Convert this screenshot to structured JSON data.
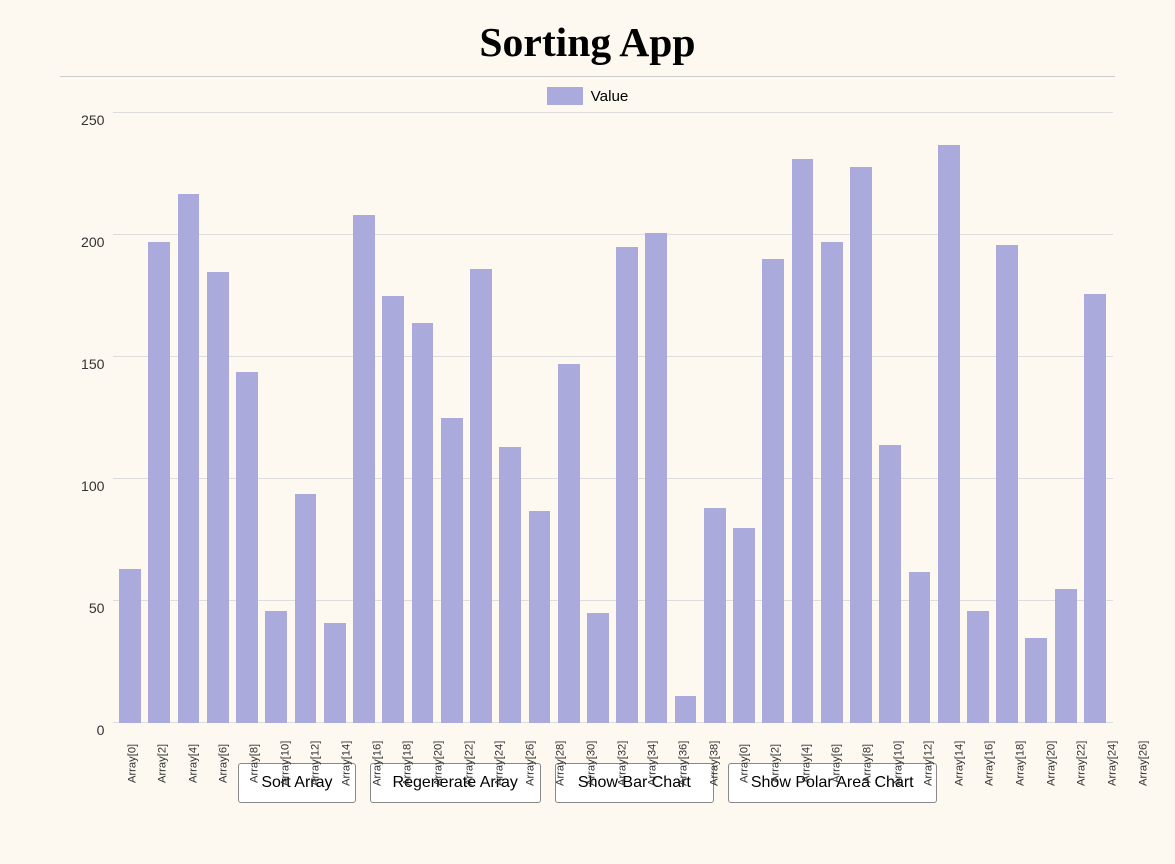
{
  "title": "Sorting App",
  "legend": {
    "label": "Value"
  },
  "chart": {
    "yAxis": {
      "ticks": [
        0,
        50,
        100,
        150,
        200,
        250
      ]
    },
    "bars": [
      {
        "label": "Array[0]",
        "value": 63
      },
      {
        "label": "Array[2]",
        "value": 197
      },
      {
        "label": "Array[4]",
        "value": 217
      },
      {
        "label": "Array[6]",
        "value": 185
      },
      {
        "label": "Array[8]",
        "value": 144
      },
      {
        "label": "Array[10]",
        "value": 46
      },
      {
        "label": "Array[12]",
        "value": 94
      },
      {
        "label": "Array[14]",
        "value": 41
      },
      {
        "label": "Array[16]",
        "value": 208
      },
      {
        "label": "Array[18]",
        "value": 175
      },
      {
        "label": "Array[20]",
        "value": 164
      },
      {
        "label": "Array[22]",
        "value": 125
      },
      {
        "label": "Array[24]",
        "value": 186
      },
      {
        "label": "Array[26]",
        "value": 113
      },
      {
        "label": "Array[28]",
        "value": 87
      },
      {
        "label": "Array[30]",
        "value": 147
      },
      {
        "label": "Array[32]",
        "value": 45
      },
      {
        "label": "Array[34]",
        "value": 195
      },
      {
        "label": "Array[36]",
        "value": 201
      },
      {
        "label": "Array[38]",
        "value": 11
      },
      {
        "label": "Array[0]",
        "value": 88
      },
      {
        "label": "Array[2]",
        "value": 80
      },
      {
        "label": "Array[4]",
        "value": 190
      },
      {
        "label": "Array[6]",
        "value": 231
      },
      {
        "label": "Array[8]",
        "value": 197
      },
      {
        "label": "Array[10]",
        "value": 228
      },
      {
        "label": "Array[12]",
        "value": 114
      },
      {
        "label": "Array[14]",
        "value": 62
      },
      {
        "label": "Array[16]",
        "value": 237
      },
      {
        "label": "Array[18]",
        "value": 46
      },
      {
        "label": "Array[20]",
        "value": 196
      },
      {
        "label": "Array[22]",
        "value": 35
      },
      {
        "label": "Array[24]",
        "value": 55
      },
      {
        "label": "Array[26]",
        "value": 176
      }
    ]
  },
  "buttons": {
    "sort": "Sort Array",
    "regenerate": "Regenerate Array",
    "bar_chart": "Show Bar Chart",
    "polar_chart": "Show Polar Area Chart"
  }
}
